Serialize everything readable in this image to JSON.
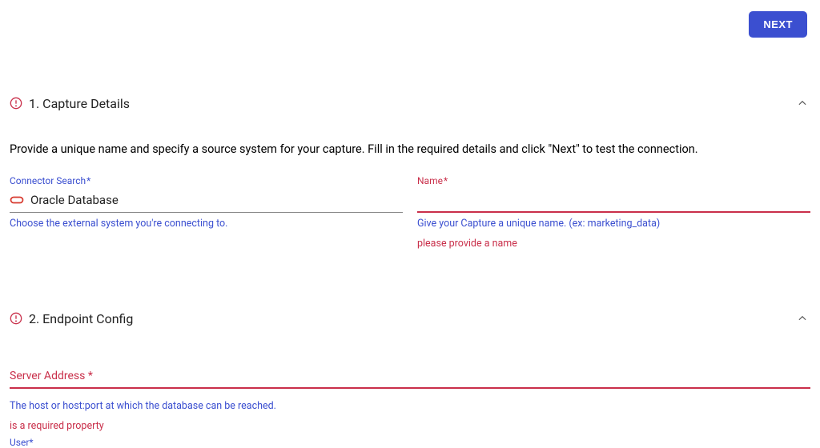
{
  "actions": {
    "next": "NEXT"
  },
  "section1": {
    "title": "1. Capture Details",
    "intro": "Provide a unique name and specify a source system for your capture. Fill in the required details and click \"Next\" to test the connection.",
    "connector": {
      "label": "Connector Search",
      "required": "*",
      "value": "Oracle Database",
      "help": "Choose the external system you're connecting to."
    },
    "name": {
      "label": "Name",
      "required": "*",
      "value": "",
      "help": "Give your Capture a unique name. (ex: marketing_data)",
      "error": "please provide a name"
    }
  },
  "section2": {
    "title": "2. Endpoint Config",
    "server": {
      "label": "Server Address",
      "required": "*",
      "help": "The host or host:port at which the database can be reached.",
      "error": "is a required property"
    },
    "user": {
      "label": "User",
      "required": "*"
    }
  }
}
